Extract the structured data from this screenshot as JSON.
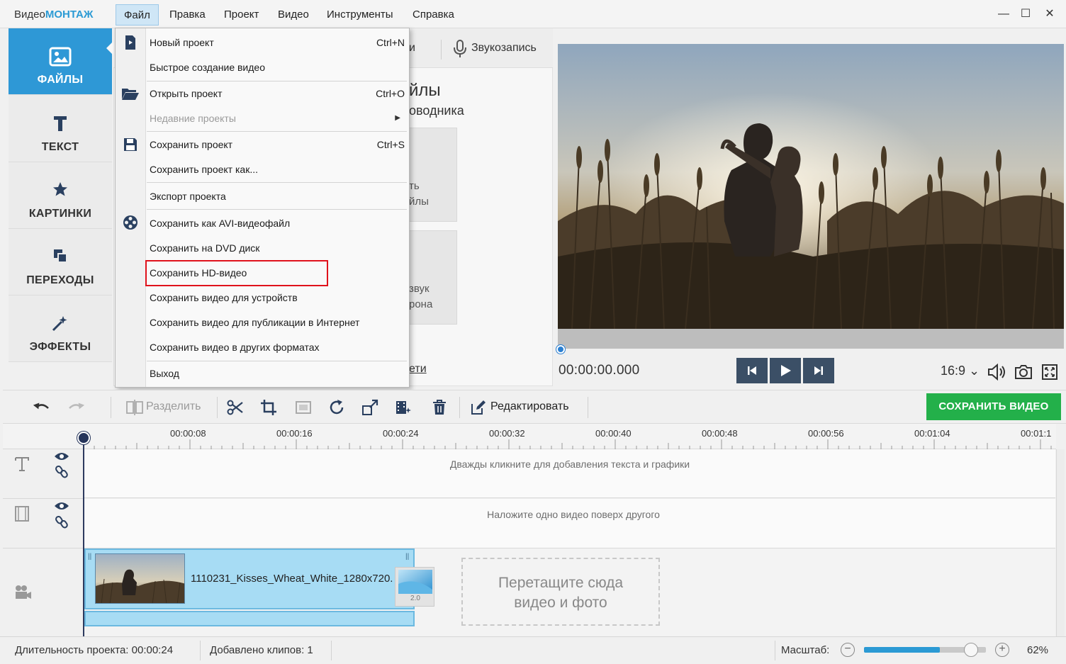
{
  "app": {
    "title_prefix": "Видео",
    "title_brand": "МОНТАЖ",
    "window_controls": {
      "minimize": "—",
      "maximize": "☐",
      "close": "✕"
    }
  },
  "menubar": [
    {
      "label": "Файл",
      "active": true
    },
    {
      "label": "Правка"
    },
    {
      "label": "Проект"
    },
    {
      "label": "Видео"
    },
    {
      "label": "Инструменты"
    },
    {
      "label": "Справка"
    }
  ],
  "sidebar": {
    "items": [
      {
        "label": "ФАЙЛЫ",
        "icon": "image-icon",
        "active": true
      },
      {
        "label": "ТЕКСТ",
        "icon": "text-icon"
      },
      {
        "label": "КАРТИНКИ",
        "icon": "star-icon"
      },
      {
        "label": "ПЕРЕХОДЫ",
        "icon": "transitions-icon"
      },
      {
        "label": "ЭФФЕКТЫ",
        "icon": "magic-wand-icon"
      }
    ]
  },
  "panel_partial": {
    "tab_fragment": "и",
    "record_label": "Звукозапись",
    "heading_fragment": "йлы",
    "subheading_fragment": "оводника",
    "card1_line1": "ть",
    "card1_line2": "йлы",
    "card2_line1": "звук",
    "card2_line2": "рона",
    "link_fragment": "ети"
  },
  "file_menu": {
    "items": [
      {
        "label": "Новый проект",
        "shortcut": "Ctrl+N",
        "icon": "new-file-icon"
      },
      {
        "label": "Быстрое создание видео"
      },
      {
        "label": "Открыть проект",
        "shortcut": "Ctrl+O",
        "icon": "folder-open-icon"
      },
      {
        "label": "Недавние проекты",
        "disabled": true,
        "submenu": true
      },
      {
        "label": "Сохранить проект",
        "shortcut": "Ctrl+S",
        "icon": "floppy-disk-icon"
      },
      {
        "label": "Сохранить проект как..."
      },
      {
        "label": "Экспорт проекта"
      },
      {
        "label": "Сохранить как AVI-видеофайл",
        "icon": "film-reel-icon"
      },
      {
        "label": "Сохранить на DVD диск"
      },
      {
        "label": "Сохранить HD-видео",
        "highlighted": true
      },
      {
        "label": "Сохранить видео для устройств"
      },
      {
        "label": "Сохранить видео для публикации в Интернет"
      },
      {
        "label": "Сохранить видео в других форматах"
      },
      {
        "label": "Выход"
      }
    ],
    "highlight_color": "#e0121c"
  },
  "player": {
    "timecode": "00:00:00.000",
    "aspect_ratio": "16:9 ⌄",
    "progress": 0.0
  },
  "toolbar": {
    "split_label": "Разделить",
    "edit_label": "Редактировать",
    "save_video_label": "СОХРАНИТЬ ВИДЕО",
    "save_color": "#23b04a"
  },
  "timeline": {
    "ticks": [
      "00:00:08",
      "00:00:16",
      "00:00:24",
      "00:00:32",
      "00:00:40",
      "00:00:48",
      "00:00:56",
      "00:01:04",
      "00:01:1"
    ],
    "text_track_hint": "Дважды кликните для добавления текста и графики",
    "overlay_track_hint": "Наложите одно видео поверх другого",
    "clip_name": "1110231_Kisses_Wheat_White_1280x720.",
    "transition_label": "2.0",
    "drop_zone_line1": "Перетащите сюда",
    "drop_zone_line2": "видео и фото"
  },
  "status": {
    "duration": "Длительность проекта:  00:00:24",
    "clips": "Добавлено клипов: 1",
    "zoom_label": "Масштаб:",
    "zoom_value": "62%",
    "zoom_fraction": 0.62
  }
}
